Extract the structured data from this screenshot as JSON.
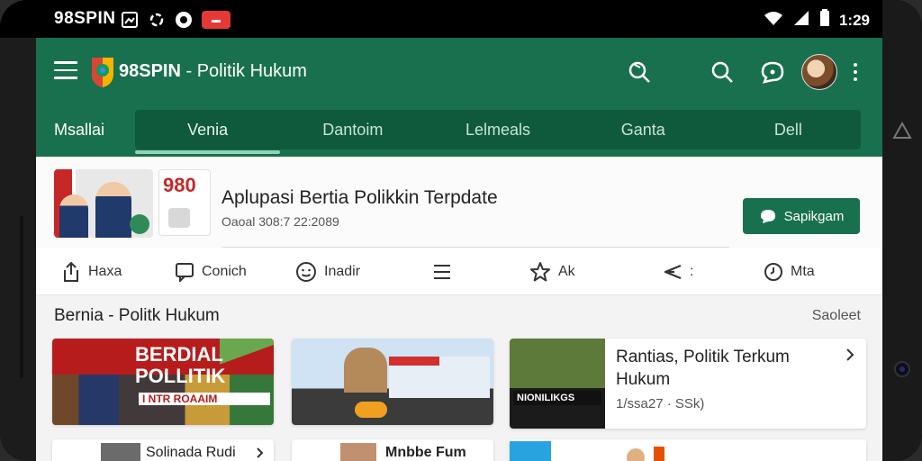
{
  "status_bar": {
    "left_text": "98SPIN",
    "right_time": "1:29",
    "icons": [
      "image-icon",
      "sync-icon",
      "record-icon",
      "notification-badge-icon",
      "wifi-icon",
      "signal-icon",
      "battery-icon"
    ]
  },
  "app_bar": {
    "title_brand": "98SPIN",
    "title_rest": " - Politik Hukum",
    "actions": [
      "search-icon",
      "search-icon",
      "chat-icon",
      "avatar",
      "more-icon"
    ]
  },
  "tabs": {
    "first": "Msallai",
    "items": [
      "Venia",
      "Dantoim",
      "Lelmeals",
      "Ganta",
      "Dell"
    ],
    "active_index": 0
  },
  "featured": {
    "logo_text": "980",
    "title": "Aplupasi Bertia Polikkin Terpdate",
    "meta": "Oaoal 308:7 22:2089",
    "button_label": "Sapikgam"
  },
  "action_bar": {
    "items": [
      {
        "label": "Haxa",
        "icon": "share-icon"
      },
      {
        "label": "Conich",
        "icon": "comment-icon"
      },
      {
        "label": "Inadir",
        "icon": "smile-icon"
      },
      {
        "label": "",
        "icon": "list-icon"
      },
      {
        "label": "Ak",
        "icon": "star-icon"
      },
      {
        "label": ":",
        "icon": "send-icon"
      },
      {
        "label": "Mta",
        "icon": "clock-icon"
      }
    ]
  },
  "section": {
    "title": "Bernia - Politk Hukum",
    "more": "Saoleet"
  },
  "cards": {
    "c1": {
      "headline": "BERDIAL POLLITIK",
      "band": "I NTR ROAAIM"
    },
    "c3": {
      "image_text": "NIONILIKGS",
      "title": "Rantias, Politik Terkum Hukum",
      "meta": "1/ssa27 · SSk)"
    },
    "c4": {
      "title": "Solinada Rudi"
    },
    "c5": {
      "title": "Mnbbe Fum"
    }
  },
  "colors": {
    "primary": "#19704e",
    "tab_strip": "#0f5a3d",
    "accent_red": "#c62828"
  }
}
